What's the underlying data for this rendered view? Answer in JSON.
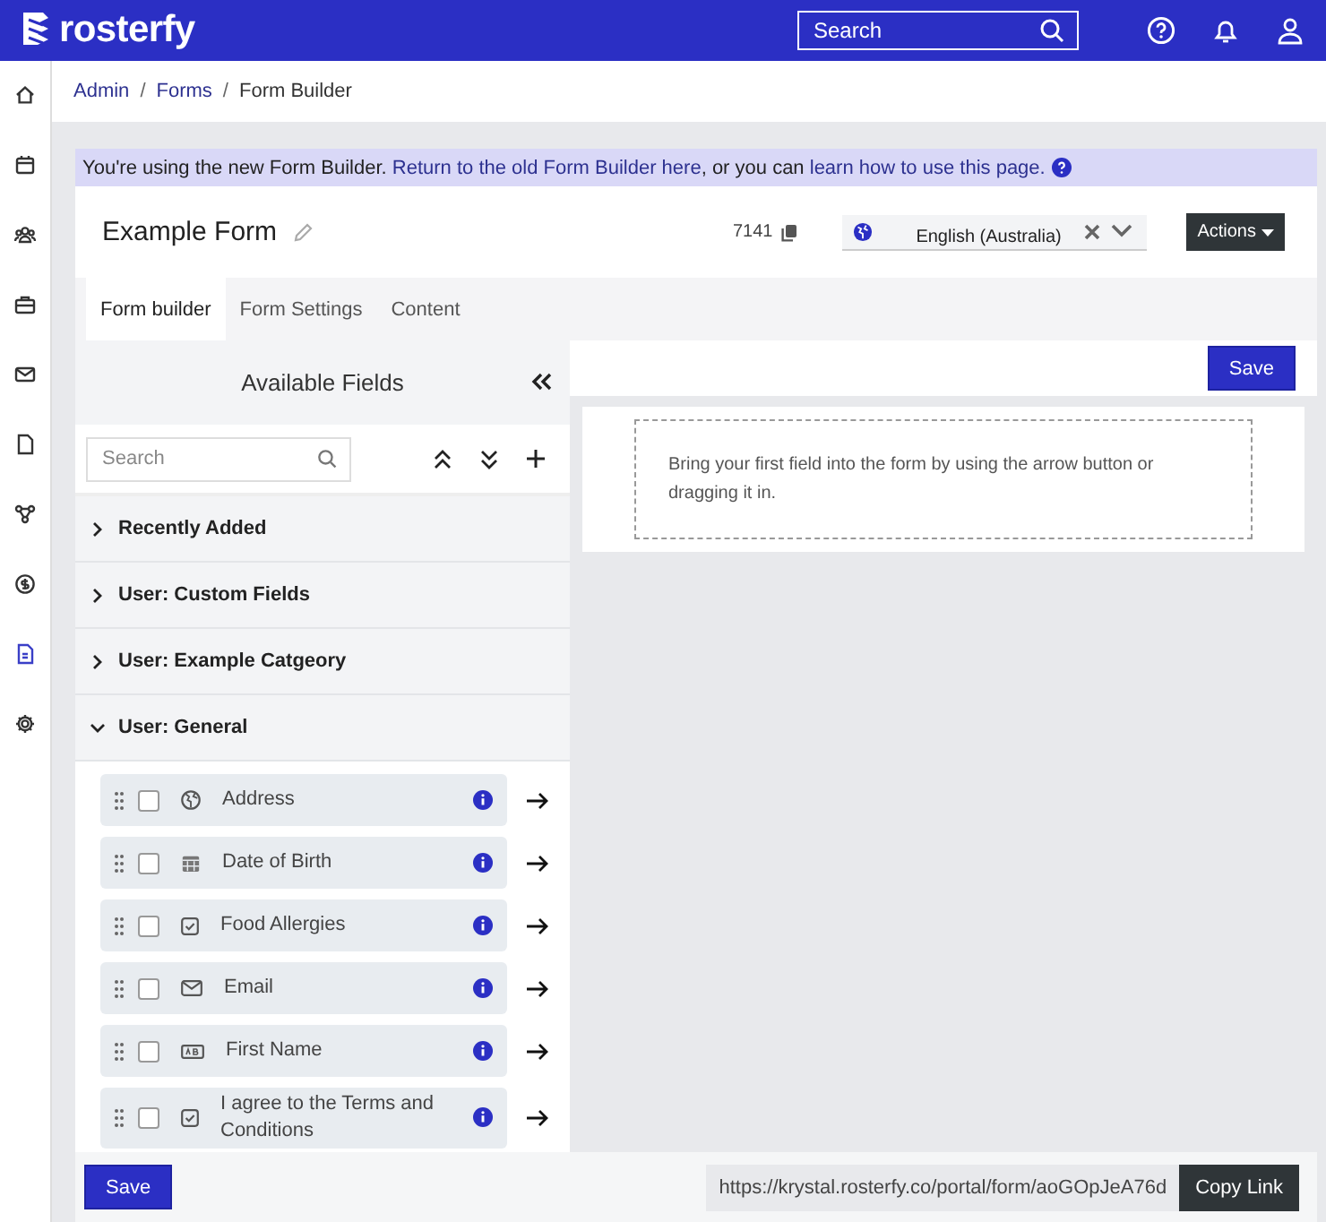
{
  "topbar": {
    "logo": "rosterfy",
    "search": {
      "placeholder": "Search"
    }
  },
  "nav": [
    {
      "selected": false
    },
    {
      "selected": false
    },
    {
      "selected": false
    },
    {
      "selected": false
    },
    {
      "selected": false
    },
    {
      "selected": false
    },
    {
      "selected": false
    },
    {
      "selected": false
    },
    {
      "selected": true
    },
    {
      "selected": false
    }
  ],
  "breadcrumb": {
    "separator": "/",
    "items": [
      {
        "label": "Admin",
        "link": true
      },
      {
        "label": "Forms",
        "link": true
      },
      {
        "label": "Form Builder",
        "link": false
      }
    ]
  },
  "banner": {
    "text": "You're using the new Form Builder.",
    "link1": "Return to the old Form Builder here",
    "middle": ", or you can",
    "link2": "learn how to use this page."
  },
  "form": {
    "title": "Example Form",
    "id": "7141",
    "language": "English (Australia)",
    "actions": "Actions"
  },
  "tabs": [
    {
      "label": "Form builder",
      "selected": true
    },
    {
      "label": "Form Settings",
      "selected": false
    },
    {
      "label": "Content",
      "selected": false
    }
  ],
  "panel": {
    "title": "Available Fields",
    "search": {
      "placeholder": "Search"
    },
    "categories": [
      {
        "label": "Recently Added",
        "expanded": false
      },
      {
        "label": "User: Custom Fields",
        "expanded": false
      },
      {
        "label": "User: Example Catgeory",
        "expanded": false
      },
      {
        "label": "User: General",
        "expanded": true
      }
    ],
    "fields": [
      {
        "label": "Address",
        "kind": "address",
        "checked": false
      },
      {
        "label": "Date of Birth",
        "kind": "date",
        "checked": false
      },
      {
        "label": "Food Allergies",
        "kind": "checkbox",
        "checked": false
      },
      {
        "label": "Email",
        "kind": "email",
        "checked": false
      },
      {
        "label": "First Name",
        "kind": "text",
        "checked": false
      },
      {
        "label": "I agree to the Terms and Conditions",
        "kind": "checkbox",
        "checked": false
      }
    ]
  },
  "canvas": {
    "save": "Save",
    "empty": "Bring your first field into the form by using the arrow button or dragging it in."
  },
  "footer": {
    "save": "Save",
    "url": "https://krystal.rosterfy.co/portal/form/aoGOpJeA76d",
    "copy": "Copy Link"
  }
}
